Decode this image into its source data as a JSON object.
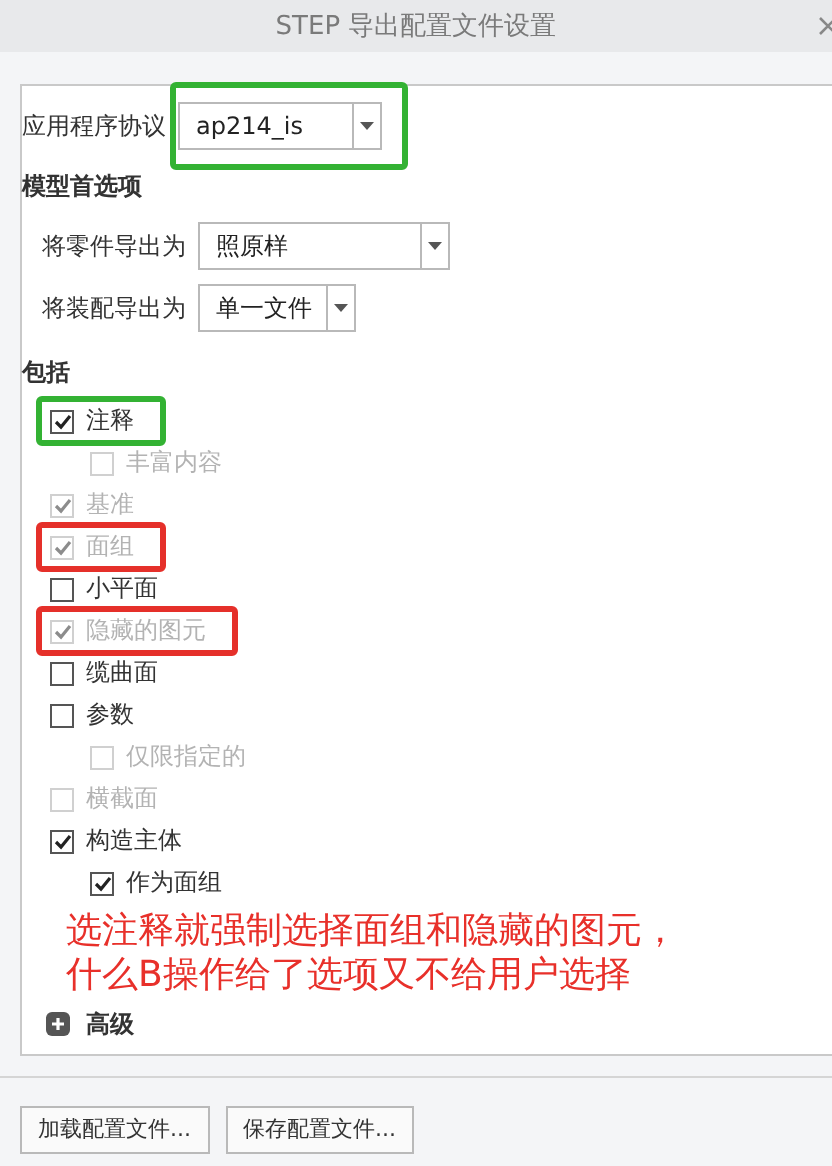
{
  "window": {
    "title": "STEP 导出配置文件设置"
  },
  "protocol": {
    "label": "应用程序协议",
    "value": "ap214_is",
    "color": "#33b233"
  },
  "model_preferences": {
    "heading": "模型首选项",
    "fields": [
      {
        "label": "将零件导出为",
        "value": "照原样"
      },
      {
        "label": "将装配导出为",
        "value": "单一文件"
      }
    ]
  },
  "include": {
    "heading": "包括",
    "items": [
      {
        "label": "注释",
        "checked": true,
        "disabled": false,
        "color": "#33b233",
        "children": [
          {
            "label": "丰富内容",
            "checked": false,
            "disabled": true
          }
        ]
      },
      {
        "label": "基准",
        "checked": true,
        "disabled": true
      },
      {
        "label": "面组",
        "checked": true,
        "disabled": true,
        "color": "#e5302a"
      },
      {
        "label": "小平面",
        "checked": false,
        "disabled": false
      },
      {
        "label": "隐藏的图元",
        "checked": true,
        "disabled": true,
        "color": "#e5302a"
      },
      {
        "label": "缆曲面",
        "checked": false,
        "disabled": false
      },
      {
        "label": "参数",
        "checked": false,
        "disabled": false,
        "children": [
          {
            "label": "仅限指定的",
            "checked": false,
            "disabled": true
          }
        ]
      },
      {
        "label": "横截面",
        "checked": false,
        "disabled": true
      },
      {
        "label": "构造主体",
        "checked": true,
        "disabled": false,
        "children": [
          {
            "label": "作为面组",
            "checked": true,
            "disabled": false
          }
        ]
      }
    ]
  },
  "advanced": {
    "label": "高级",
    "expanded": false
  },
  "note": [
    "选注释就强制选择面组和隐藏的图元，",
    "什么B操作给了选项又不给用户选择"
  ],
  "buttons": [
    "加载配置文件...",
    "保存配置文件..."
  ]
}
